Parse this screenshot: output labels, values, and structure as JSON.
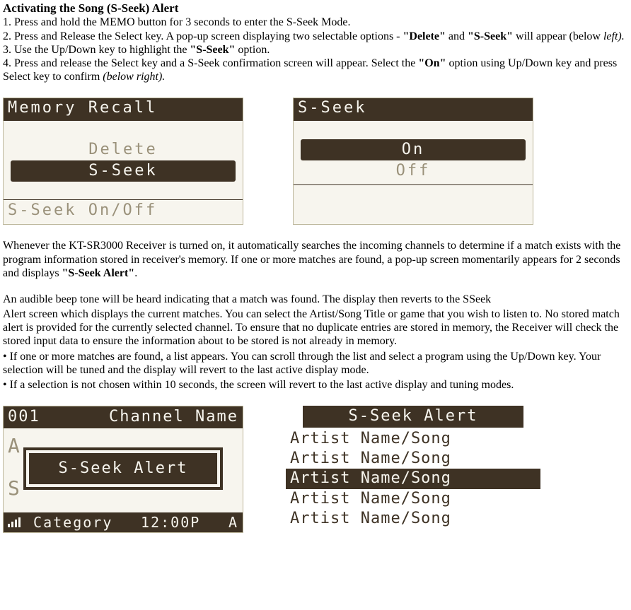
{
  "title": "Activating the Song (S-Seek) Alert",
  "steps": {
    "s1": "1. Press and hold the MEMO button for 3 seconds to enter the S-Seek Mode.",
    "s2a": "2. Press and Release the Select key. A pop-up screen displaying two selectable options - ",
    "s2_b1": "\"Delete\"",
    "s2_mid": " and ",
    "s2_b2": "\"S-Seek\"",
    "s2b": " will appear (below ",
    "s2_it": "left).",
    "s3a": "3. Use the Up/Down key to highlight the ",
    "s3_b": "\"S-Seek\"",
    "s3b": " option.",
    "s4a": "4. Press and release the Select key and a S-Seek confirmation screen will appear. Select the ",
    "s4_b": "\"On\"",
    "s4b": " option using Up/Down key and press Select key to confirm ",
    "s4_it": "(below right)."
  },
  "screen1": {
    "header": "Memory Recall",
    "opt_delete": "Delete",
    "opt_sseek": "S-Seek",
    "footer": "S-Seek On/Off"
  },
  "screen2": {
    "header": "S-Seek",
    "opt_on": "On",
    "opt_off": "Off"
  },
  "para1a": "Whenever the KT-SR3000 Receiver is turned on, it automatically searches the incoming channels to determine if a match exists with the program information stored in receiver's memory. If one or more matches are found, a pop-up screen momentarily appears for 2 seconds and displays ",
  "para1_b": "\"S-Seek Alert\"",
  "para1c": ".",
  "para2": "An audible beep tone will be heard indicating that a match was found. The display then reverts to the SSeek",
  "para3": "Alert screen which displays the current matches. You can select the Artist/Song Title or game that you wish to listen to. No stored match alert is provided for the currently selected channel. To ensure that no duplicate entries are stored in memory, the Receiver will check the stored input data to ensure the information about to be stored is not already in memory.",
  "bullet1": "• If one or more matches are found, a list appears. You can scroll through the list and select a program using the Up/Down key. Your selection will be tuned and the display will revert to the last active display mode.",
  "bullet2": "• If a selection is not chosen within 10 seconds, the screen will revert to the last active display and tuning modes.",
  "screen3": {
    "ch_num": "001",
    "ch_name": "Channel Name",
    "ghost1": "A",
    "ghost2": "S",
    "popup": "S-Seek Alert",
    "category": "Category",
    "time": "12:00P",
    "ant": "A"
  },
  "screen4": {
    "title": "S-Seek Alert",
    "rows": [
      "Artist Name/Song",
      "Artist Name/Song",
      "Artist Name/Song",
      "Artist Name/Song",
      "Artist Name/Song"
    ]
  }
}
